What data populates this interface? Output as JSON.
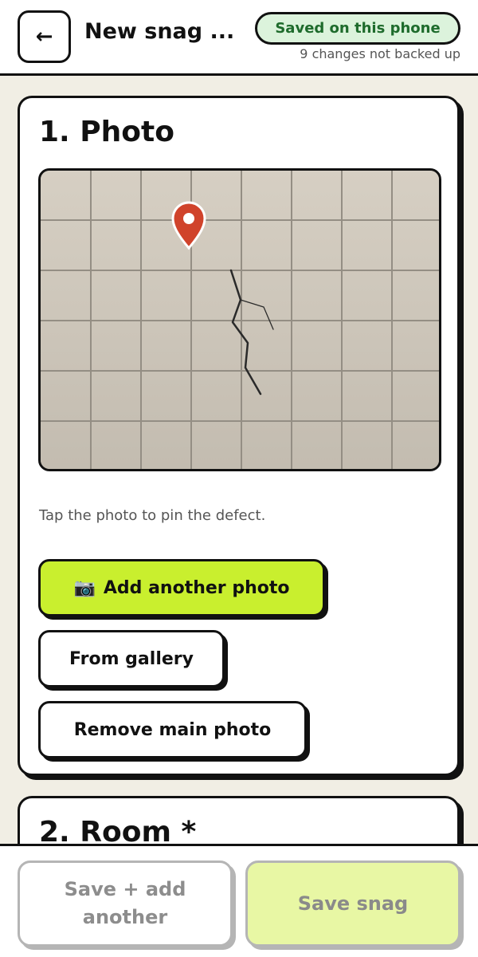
{
  "header": {
    "back_glyph": "←",
    "title": "New snag ...",
    "saved_badge": "Saved on this phone",
    "backup_status": "9 changes not backed up"
  },
  "photo_section": {
    "title": "1. Photo",
    "hint": "Tap the photo to pin the defect.",
    "add_photo_icon": "📷",
    "add_photo_label": "Add another photo",
    "gallery_label": "From gallery",
    "remove_label": "Remove main photo"
  },
  "room_section": {
    "title": "2. Room *"
  },
  "footer": {
    "save_add_another_label": "Save + add another",
    "save_snag_label": "Save snag"
  },
  "colors": {
    "accent": "#c9ef2e",
    "saved_badge_bg": "#dcf3dc",
    "saved_badge_text": "#1e6b2c",
    "pin": "#d0432b",
    "page_bg": "#f1eee4"
  },
  "icons": {
    "back": "arrow-left-icon",
    "pin": "map-pin-icon",
    "camera": "camera-icon"
  }
}
